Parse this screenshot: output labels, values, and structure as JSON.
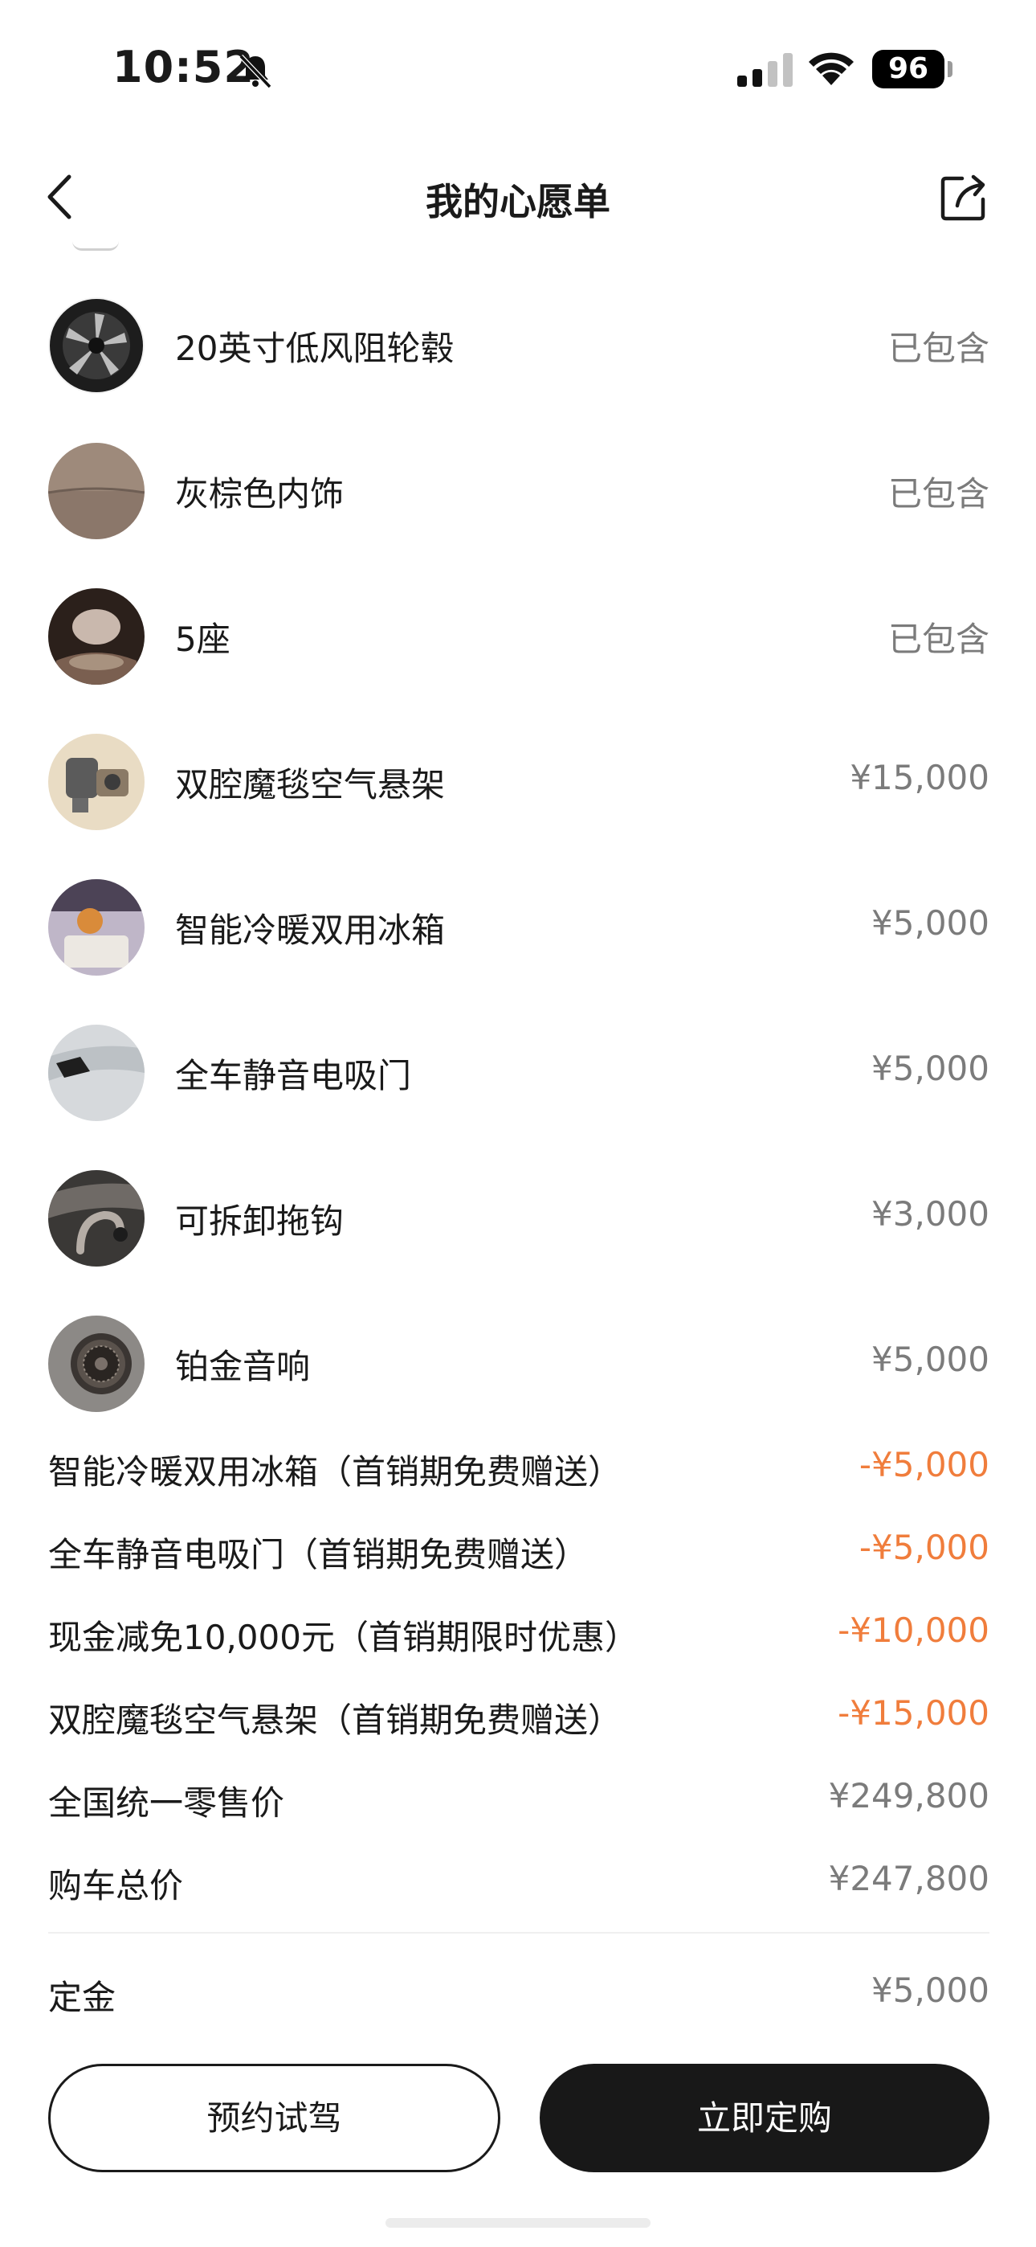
{
  "status_bar": {
    "time": "10:52",
    "battery": "96",
    "icons": [
      "bell-slash-icon",
      "cellular-signal-icon",
      "wifi-icon",
      "battery-icon"
    ]
  },
  "header": {
    "title": "我的心愿单",
    "icons": [
      "back-chevron-icon",
      "share-icon"
    ]
  },
  "options": [
    {
      "name": "20英寸低风阻轮毂",
      "price": "已包含",
      "thumb": "wheel-thumbnail"
    },
    {
      "name": "灰棕色内饰",
      "price": "已包含",
      "thumb": "interior-fabric-thumbnail"
    },
    {
      "name": "5座",
      "price": "已包含",
      "thumb": "seat-thumbnail"
    },
    {
      "name": "双腔魔毯空气悬架",
      "price": "¥15,000",
      "thumb": "air-suspension-thumbnail"
    },
    {
      "name": "智能冷暖双用冰箱",
      "price": "¥5,000",
      "thumb": "fridge-thumbnail"
    },
    {
      "name": "全车静音电吸门",
      "price": "¥5,000",
      "thumb": "soft-close-door-thumbnail"
    },
    {
      "name": "可拆卸拖钩",
      "price": "¥3,000",
      "thumb": "tow-hook-thumbnail"
    },
    {
      "name": "铂金音响",
      "price": "¥5,000",
      "thumb": "speaker-thumbnail"
    }
  ],
  "summary": [
    {
      "label": "智能冷暖双用冰箱（首销期免费赠送）",
      "value": "-¥5,000",
      "kind": "discount"
    },
    {
      "label": "全车静音电吸门（首销期免费赠送）",
      "value": "-¥5,000",
      "kind": "discount"
    },
    {
      "label": "现金减免10,000元（首销期限时优惠）",
      "value": "-¥10,000",
      "kind": "discount"
    },
    {
      "label": "双腔魔毯空气悬架（首销期免费赠送）",
      "value": "-¥15,000",
      "kind": "discount"
    },
    {
      "label": "全国统一零售价",
      "value": "¥249,800",
      "kind": "plain"
    },
    {
      "label": "购车总价",
      "value": "¥247,800",
      "kind": "plain"
    }
  ],
  "deposit": {
    "label": "定金",
    "value": "¥5,000"
  },
  "actions": {
    "test_drive": "预约试驾",
    "order_now": "立即定购"
  },
  "colors": {
    "discount": "#f07d3c",
    "secondary_text": "#7b7b7b",
    "primary_button_bg": "#181818",
    "primary_text": "#1a1a1a"
  }
}
